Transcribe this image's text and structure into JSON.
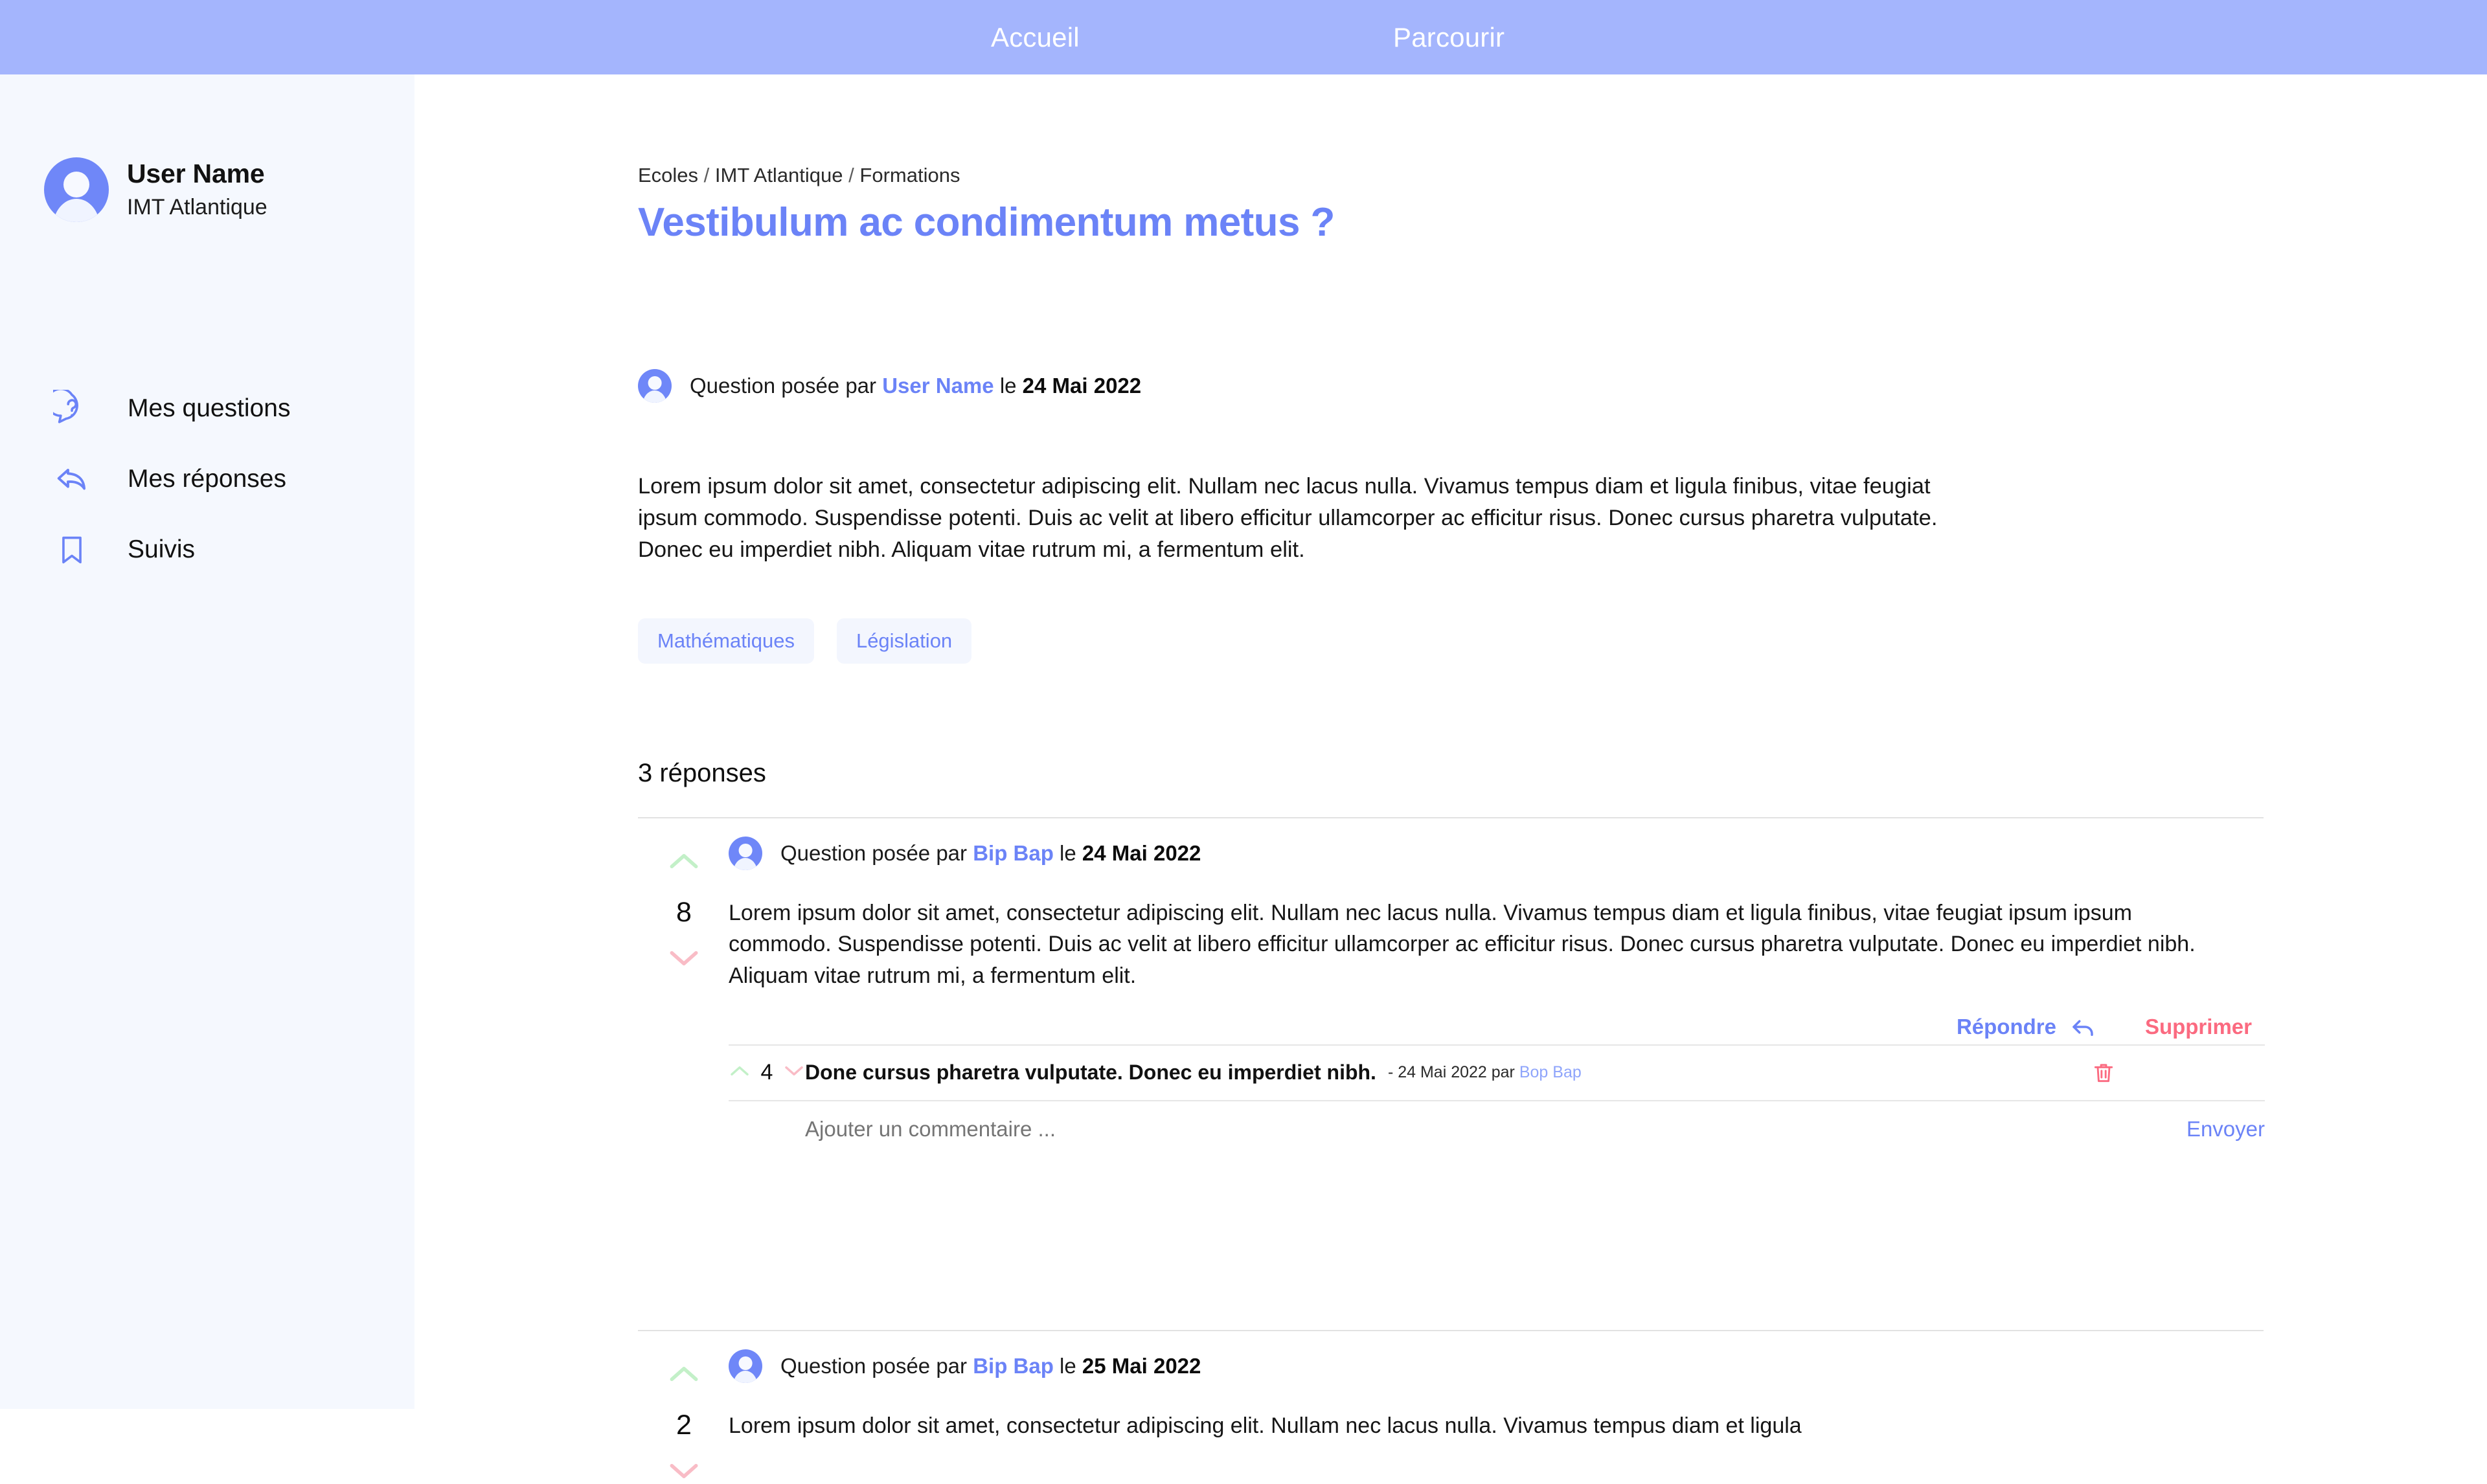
{
  "topnav": {
    "home_label": "Accueil",
    "browse_label": "Parcourir"
  },
  "sidebar": {
    "profile": {
      "name": "User Name",
      "organization": "IMT Atlantique"
    },
    "items": [
      {
        "label": "Mes questions",
        "icon": "question-bubble-icon"
      },
      {
        "label": "Mes réponses",
        "icon": "reply-arrow-icon"
      },
      {
        "label": "Suivis",
        "icon": "bookmark-icon"
      }
    ]
  },
  "breadcrumb": {
    "items": [
      "Ecoles",
      "IMT Atlantique",
      "Formations"
    ],
    "separator": "/"
  },
  "question": {
    "title": "Vestibulum ac condimentum metus ?",
    "meta_prefix": "Question posée par",
    "author": "User Name",
    "meta_middle": "le",
    "date": "24 Mai 2022",
    "body": "Lorem ipsum dolor sit amet, consectetur adipiscing elit. Nullam nec lacus nulla. Vivamus tempus diam et ligula finibus, vitae feugiat ipsum commodo. Suspendisse potenti. Duis ac velit at libero efficitur ullamcorper ac efficitur risus. Donec cursus pharetra vulputate. Donec eu imperdiet nibh. Aliquam vitae rutrum mi, a fermentum elit.",
    "tags": [
      "Mathématiques",
      "Législation"
    ]
  },
  "answers_section": {
    "count_label": "3 réponses"
  },
  "answers": [
    {
      "votes": "8",
      "meta_prefix": "Question posée par",
      "author": "Bip Bap",
      "meta_middle": "le",
      "date": "24 Mai 2022",
      "body": "Lorem ipsum dolor sit amet, consectetur adipiscing elit. Nullam nec lacus nulla. Vivamus tempus diam et ligula finibus, vitae feugiat ipsum ipsum commodo. Suspendisse potenti. Duis ac velit at libero efficitur ullamcorper ac efficitur risus. Donec cursus pharetra vulputate. Donec eu imperdiet nibh. Aliquam vitae rutrum mi, a fermentum elit.",
      "reply_label": "Répondre",
      "delete_label": "Supprimer",
      "comment": {
        "votes": "4",
        "text": "Done cursus pharetra vulputate. Donec eu imperdiet nibh.",
        "meta": "- 24 Mai 2022 par",
        "author": "Bop Bap"
      },
      "comment_input": {
        "placeholder": "Ajouter un commentaire ...",
        "send_label": "Envoyer"
      }
    },
    {
      "votes": "2",
      "meta_prefix": "Question posée par",
      "author": "Bip Bap",
      "meta_middle": "le",
      "date": "25 Mai 2022",
      "body": "Lorem ipsum dolor sit amet, consectetur adipiscing elit. Nullam nec lacus nulla. Vivamus tempus diam et ligula"
    }
  ],
  "colors": {
    "header_bg": "#a4b5fd",
    "sidebar_bg": "#f5f8fe",
    "accent_blue": "#6b83f7",
    "danger_pink": "#fb6a80",
    "upvote_green": "#c3f0c8",
    "downvote_pink": "#f9bcc6",
    "tag_bg": "#f3f6fe"
  }
}
